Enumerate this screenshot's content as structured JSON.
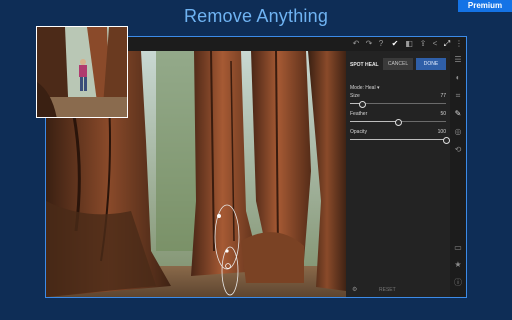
{
  "headline": "Remove Anything",
  "badge": "Premium",
  "colors": {
    "background": "#0e2d56",
    "headline": "#6fb3f2",
    "premium_badge": "#1473e6",
    "frame_border": "#3c8be8",
    "done_button": "#2f5fa8"
  },
  "toolbar_icons": [
    "undo-icon",
    "redo-icon",
    "help-icon",
    "check-circle-icon",
    "compare-icon",
    "export-icon",
    "share-icon",
    "fullscreen-icon",
    "more-icon"
  ],
  "spot_heal": {
    "title": "SPOT HEAL",
    "cancel": "CANCEL",
    "done": "DONE",
    "mode": "Mode: Heal",
    "sliders": [
      {
        "label": "Size",
        "value": 77
      },
      {
        "label": "Feather",
        "value": 50
      },
      {
        "label": "Opacity",
        "value": 100
      }
    ],
    "reset": "RESET"
  },
  "rail_icons": [
    "presets-icon",
    "color-icon",
    "crop-icon",
    "healing-brush-icon",
    "detail-icon",
    "history-icon",
    "comment-icon",
    "star-icon",
    "info-icon"
  ]
}
